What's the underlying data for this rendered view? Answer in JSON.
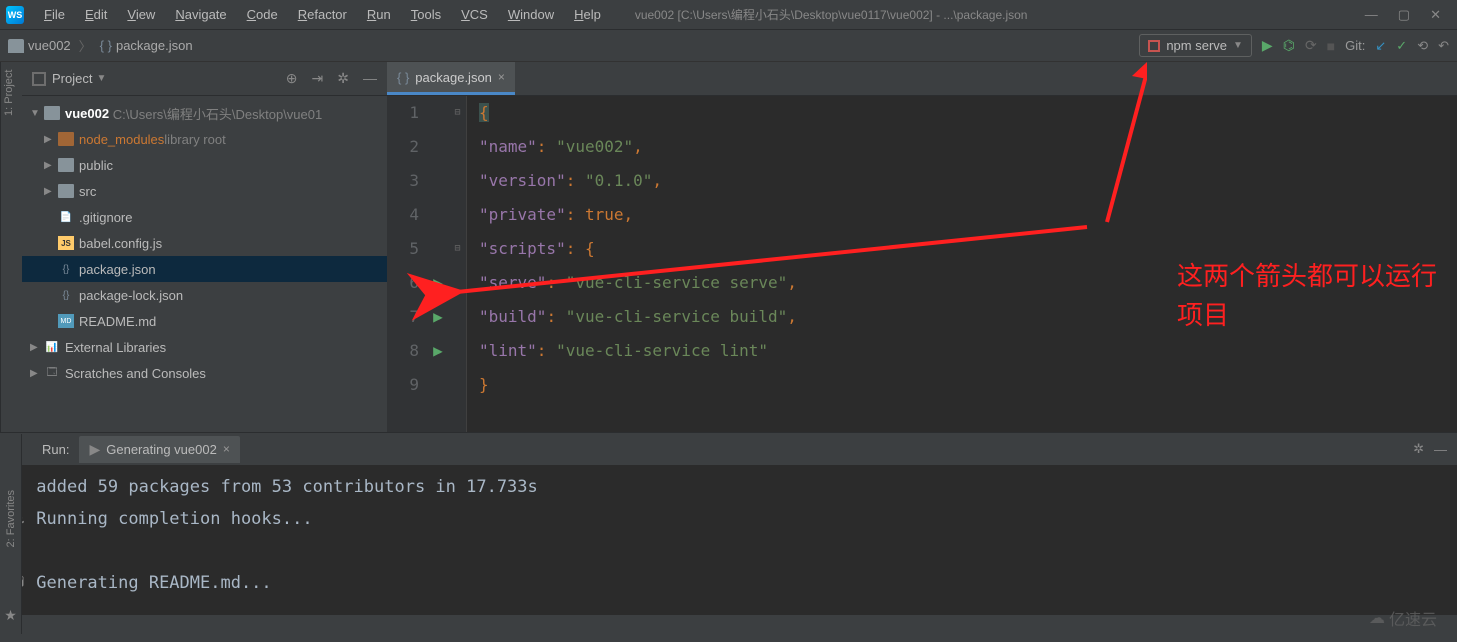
{
  "menus": [
    "File",
    "Edit",
    "View",
    "Navigate",
    "Code",
    "Refactor",
    "Run",
    "Tools",
    "VCS",
    "Window",
    "Help"
  ],
  "window_title": "vue002 [C:\\Users\\编程小石头\\Desktop\\vue0117\\vue002] - ...\\package.json",
  "breadcrumb": {
    "folder": "vue002",
    "file": "package.json"
  },
  "run_config": "npm serve",
  "git_label": "Git:",
  "project_panel": {
    "title": "Project",
    "root": {
      "name": "vue002",
      "path": "C:\\Users\\编程小石头\\Desktop\\vue01"
    },
    "items": [
      {
        "label": "node_modules",
        "suffix": "library root",
        "indent": 1,
        "arrow": "▶",
        "icon": "folder-orange",
        "cls": "orange"
      },
      {
        "label": "public",
        "indent": 1,
        "arrow": "▶",
        "icon": "folder"
      },
      {
        "label": "src",
        "indent": 1,
        "arrow": "▶",
        "icon": "folder"
      },
      {
        "label": ".gitignore",
        "indent": 1,
        "arrow": "",
        "icon": "file"
      },
      {
        "label": "babel.config.js",
        "indent": 1,
        "arrow": "",
        "icon": "js"
      },
      {
        "label": "package.json",
        "indent": 1,
        "arrow": "",
        "icon": "json",
        "selected": true
      },
      {
        "label": "package-lock.json",
        "indent": 1,
        "arrow": "",
        "icon": "json"
      },
      {
        "label": "README.md",
        "indent": 1,
        "arrow": "",
        "icon": "md"
      }
    ],
    "external": "External Libraries",
    "scratches": "Scratches and Consoles"
  },
  "editor": {
    "tab": "package.json",
    "lines": [
      {
        "n": 1,
        "mark": "",
        "html": "<span class='brace-hl tok-punc'>{</span>"
      },
      {
        "n": 2,
        "mark": "",
        "html": "  <span class='tok-key'>\"name\"</span><span class='tok-punc'>:</span> <span class='tok-str'>\"vue002\"</span><span class='tok-punc'>,</span>"
      },
      {
        "n": 3,
        "mark": "",
        "html": "  <span class='tok-key'>\"version\"</span><span class='tok-punc'>:</span> <span class='tok-str'>\"0.1.0\"</span><span class='tok-punc'>,</span>"
      },
      {
        "n": 4,
        "mark": "",
        "html": "  <span class='tok-key'>\"private\"</span><span class='tok-punc'>:</span> <span class='tok-kw'>true</span><span class='tok-punc'>,</span>"
      },
      {
        "n": 5,
        "mark": "",
        "html": "  <span class='tok-key'>\"scripts\"</span><span class='tok-punc'>:</span> <span class='tok-punc'>{</span>"
      },
      {
        "n": 6,
        "mark": "▶",
        "html": "    <span class='tok-key'>\"serve\"</span><span class='tok-punc'>:</span> <span class='tok-str'>\"vue-cli-service serve\"</span><span class='tok-punc'>,</span>"
      },
      {
        "n": 7,
        "mark": "▶",
        "html": "    <span class='tok-key'>\"build\"</span><span class='tok-punc'>:</span> <span class='tok-str'>\"vue-cli-service build\"</span><span class='tok-punc'>,</span>"
      },
      {
        "n": 8,
        "mark": "▶",
        "html": "    <span class='tok-key'>\"lint\"</span><span class='tok-punc'>:</span> <span class='tok-str'>\"vue-cli-service lint\"</span>"
      },
      {
        "n": 9,
        "mark": "",
        "html": "  <span class='tok-punc'>}</span>"
      }
    ]
  },
  "annotation_text": "这两个箭头都可以运行\n项目",
  "run_panel": {
    "title": "Run:",
    "tab": "Generating vue002",
    "console": [
      {
        "prefix": "",
        "text": "added 59 packages from 53 contributors in 17.733s"
      },
      {
        "prefix": "⚓",
        "text": "Running completion hooks..."
      },
      {
        "prefix": "",
        "text": ""
      },
      {
        "prefix": "�",
        "text": "Generating README.md..."
      }
    ]
  },
  "left_vtab_top": "1: Project",
  "left_vtab_bottom": "2: Favorites",
  "watermark": "亿速云"
}
